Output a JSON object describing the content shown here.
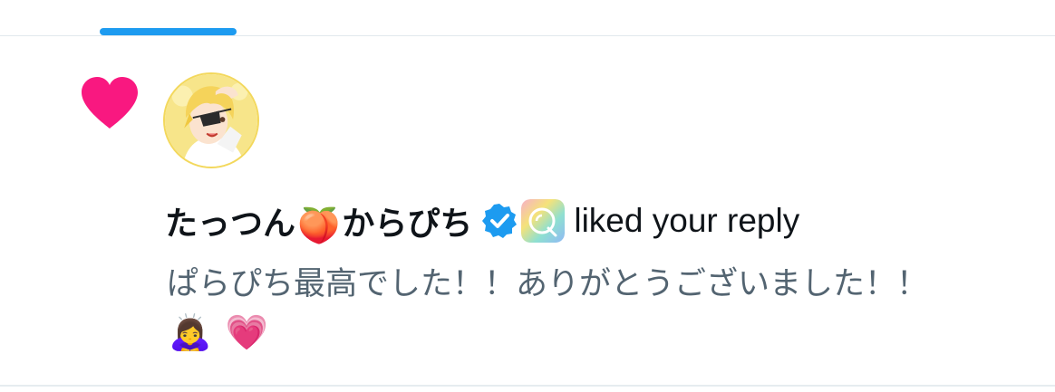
{
  "colors": {
    "tab_indicator": "#1d9bf0",
    "heart": "#f91880",
    "verified": "#1d9bf0",
    "primary_text": "#0f1419",
    "secondary_text": "#536471"
  },
  "tab": {
    "indicator_icon": "active-tab-underline"
  },
  "notification": {
    "type_icon": "heart-icon",
    "avatar_icon": "user-avatar",
    "name_part1": "たっつん",
    "name_emoji1": "🍑",
    "name_part2": "からぴち",
    "verified_icon": "verified-badge-icon",
    "affiliate_icon": "affiliate-badge-icon",
    "action": "liked your reply",
    "reply_text": "ぱらぴち最高でした！！ありがとうございました！！",
    "reply_emoji1": "🙇‍♀️",
    "reply_emoji2": "💗"
  }
}
